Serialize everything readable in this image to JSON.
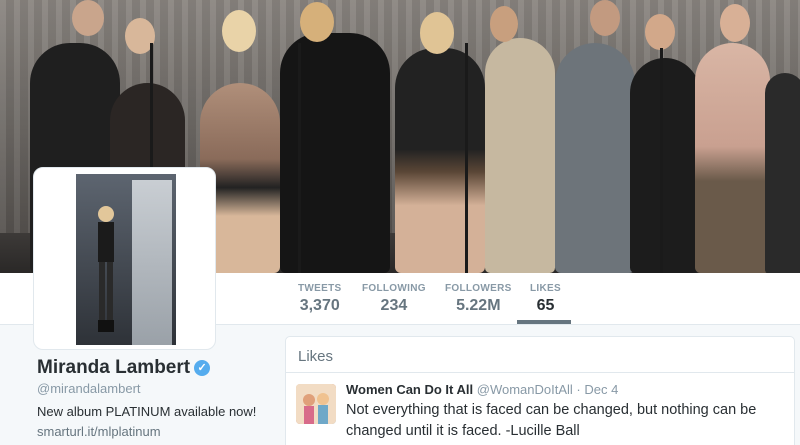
{
  "header_photo": {
    "alt": ""
  },
  "stats": [
    {
      "label": "TWEETS",
      "value": "3,370"
    },
    {
      "label": "FOLLOWING",
      "value": "234"
    },
    {
      "label": "FOLLOWERS",
      "value": "5.22M"
    },
    {
      "label": "LIKES",
      "value": "65",
      "active": true
    }
  ],
  "profile": {
    "name": "Miranda Lambert",
    "handle": "@mirandalambert",
    "bio": "New album PLATINUM available now!",
    "url": "smarturl.it/mlplatinum",
    "verified_icon": "checkmark-icon"
  },
  "timeline": {
    "title": "Likes",
    "tweet": {
      "author": "Women Can Do It All",
      "handle": "@WomanDoItAll",
      "separator": "·",
      "date": "Dec 4",
      "text": "Not everything that is faced can be changed, but nothing can be changed until it is faced. -Lucille Ball"
    }
  },
  "colors": {
    "accent": "#55acee",
    "text": "#292f33",
    "muted": "#8899a6"
  }
}
